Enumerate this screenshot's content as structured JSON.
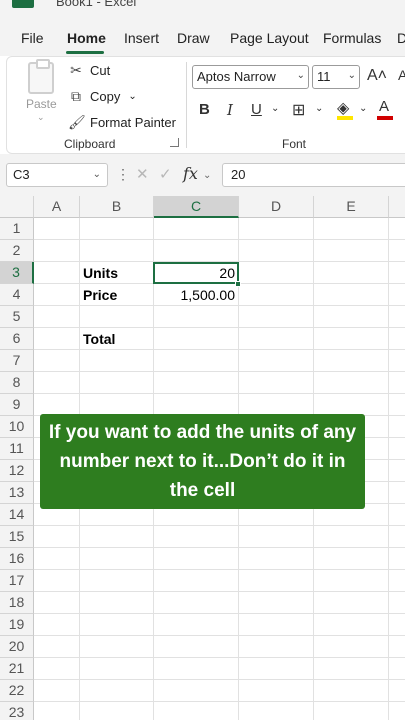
{
  "app": {
    "title": "Book1 - Excel"
  },
  "tabs": [
    "File",
    "Home",
    "Insert",
    "Draw",
    "Page Layout",
    "Formulas",
    "D"
  ],
  "ribbon": {
    "paste_label": "Paste",
    "cut_label": "Cut",
    "copy_label": "Copy",
    "format_painter_label": "Format Painter",
    "clipboard_group": "Clipboard",
    "font_group": "Font",
    "font_name": "Aptos Narrow",
    "font_size": "11"
  },
  "formula_bar": {
    "name_box": "C3",
    "formula": "20"
  },
  "grid": {
    "columns": [
      "A",
      "B",
      "C",
      "D",
      "E"
    ],
    "rows": [
      "1",
      "2",
      "3",
      "4",
      "5",
      "6",
      "7",
      "8",
      "9",
      "10",
      "11",
      "12",
      "13",
      "14",
      "15",
      "16",
      "17",
      "18",
      "19",
      "20",
      "21",
      "22",
      "23"
    ],
    "cells": {
      "B3": "Units",
      "C3": "20",
      "B4": "Price",
      "C4": "1,500.00",
      "B6": "Total"
    },
    "active_cell": "C3"
  },
  "caption": "If you want to add the units of any number next to it...Don’t do it in the cell",
  "colors": {
    "accent": "#1d6f42",
    "caption_bg": "#2e7d1f"
  }
}
